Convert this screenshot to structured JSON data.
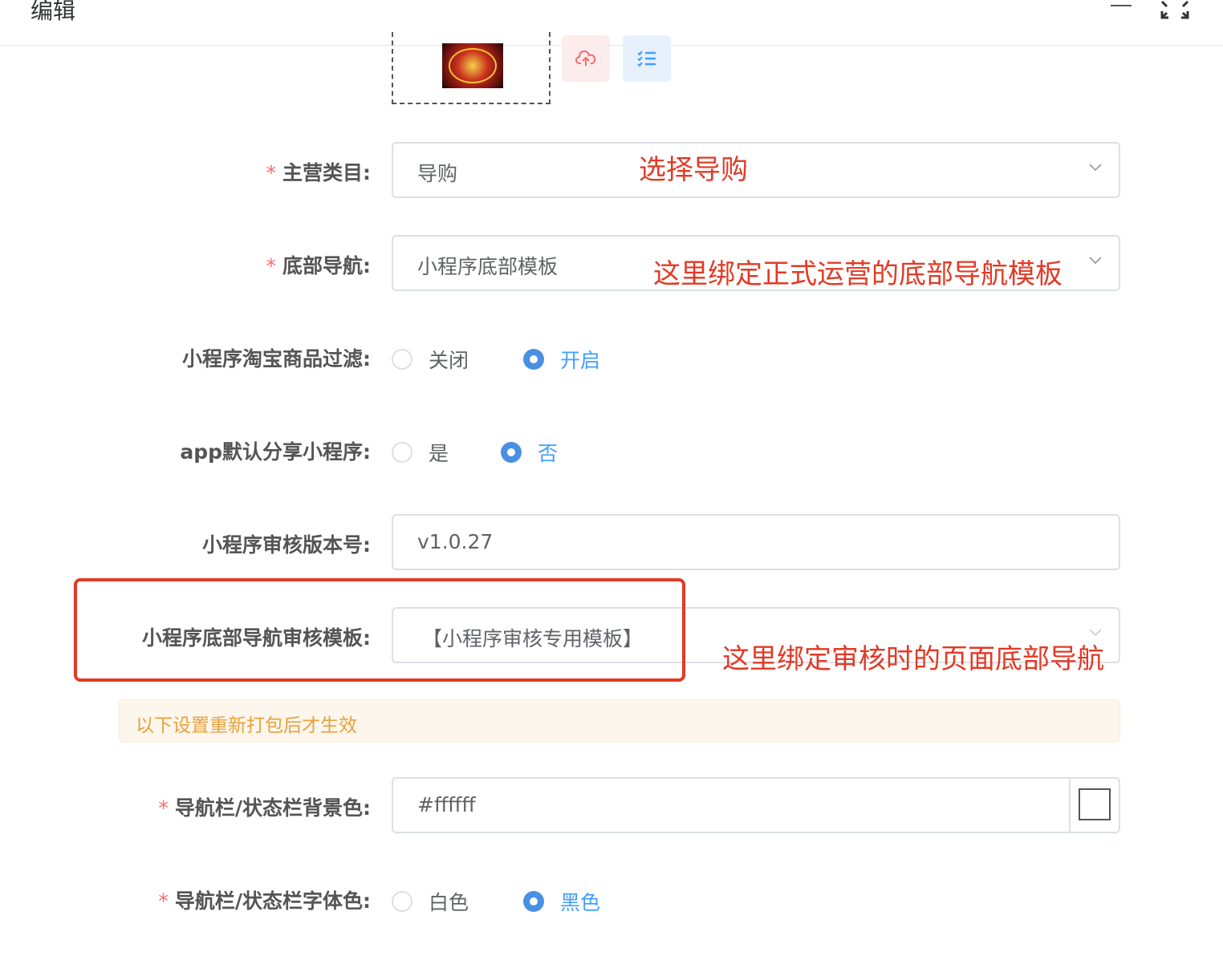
{
  "dialog": {
    "title": "编辑"
  },
  "form": {
    "main_category": {
      "label": "主营类目:",
      "value": "导购"
    },
    "bottom_nav": {
      "label": "底部导航:",
      "value": "小程序底部模板"
    },
    "taobao_filter": {
      "label": "小程序淘宝商品过滤:",
      "options": [
        "关闭",
        "开启"
      ],
      "selected": "开启"
    },
    "app_share": {
      "label": "app默认分享小程序:",
      "options": [
        "是",
        "否"
      ],
      "selected": "否"
    },
    "review_version": {
      "label": "小程序审核版本号:",
      "value": "v1.0.27"
    },
    "review_nav_template": {
      "label": "小程序底部导航审核模板:",
      "value": "【小程序审核专用模板】"
    },
    "notice": "以下设置重新打包后才生效",
    "navbar_bg_color": {
      "label": "导航栏/状态栏背景色:",
      "value": "#ffffff",
      "swatch_color": "#ffffff"
    },
    "navbar_font_color": {
      "label": "导航栏/状态栏字体色:",
      "options": [
        "白色",
        "黑色"
      ],
      "selected": "黑色"
    }
  },
  "annotations": {
    "select_guide": "选择导购",
    "bind_nav": "这里绑定正式运营的底部导航模板",
    "bind_review": "这里绑定审核时的页面底部导航"
  },
  "colors": {
    "accent": "#409eff",
    "radio_on": "#4a90e2",
    "required": "#f56c6c",
    "annotation": "#e23a25",
    "warning": "#e6a23c"
  }
}
